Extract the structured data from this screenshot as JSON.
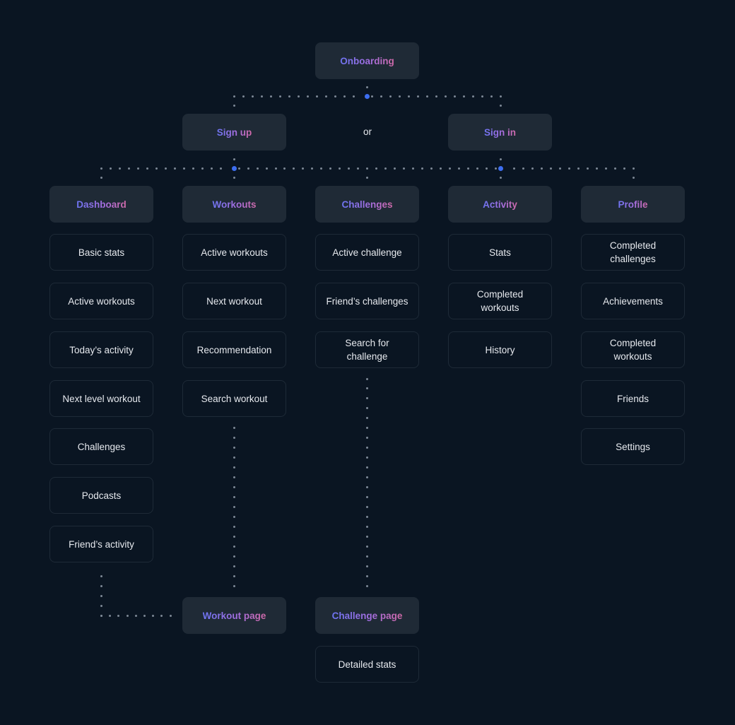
{
  "diagram": {
    "type": "sitemap",
    "colors": {
      "background": "#0a1522",
      "header_fill": "#1f2a36",
      "item_border": "#1e2a37",
      "item_text": "#e6e9ee",
      "header_text_gradient": [
        "#6d74f2",
        "#a46ee0",
        "#d16aa8"
      ],
      "connector_dot": "#7d8896",
      "hub_dot": "#3d6ef0"
    },
    "root": {
      "label": "Onboarding"
    },
    "auth": {
      "sign_up": "Sign up",
      "separator": "or",
      "sign_in": "Sign in"
    },
    "sections": [
      {
        "label": "Dashboard",
        "items": [
          "Basic stats",
          "Active workouts",
          "Today’s activity",
          "Next level workout",
          "Challenges",
          "Podcasts",
          "Friend’s activity"
        ]
      },
      {
        "label": "Workouts",
        "items": [
          "Active workouts",
          "Next workout",
          "Recommendation",
          "Search workout"
        ]
      },
      {
        "label": "Challenges",
        "items": [
          "Active challenge",
          "Friend’s challenges",
          "Search for\nchallenge"
        ]
      },
      {
        "label": "Activity",
        "items": [
          "Stats",
          "Completed\nworkouts",
          "History"
        ]
      },
      {
        "label": "Profile",
        "items": [
          "Completed\nchallenges",
          "Achievements",
          "Completed\nworkouts",
          "Friends",
          "Settings"
        ]
      }
    ],
    "detail_pages": {
      "workout_page": {
        "label": "Workout page"
      },
      "challenge_page": {
        "label": "Challenge page",
        "items": [
          "Detailed stats"
        ]
      }
    },
    "edges": [
      [
        "Onboarding",
        "Sign up"
      ],
      [
        "Onboarding",
        "Sign in"
      ],
      [
        "Sign up",
        "Sections"
      ],
      [
        "Sign in",
        "Sections"
      ],
      [
        "Dashboard",
        "Workout page"
      ],
      [
        "Workouts",
        "Workout page"
      ],
      [
        "Challenges",
        "Challenge page"
      ]
    ]
  }
}
